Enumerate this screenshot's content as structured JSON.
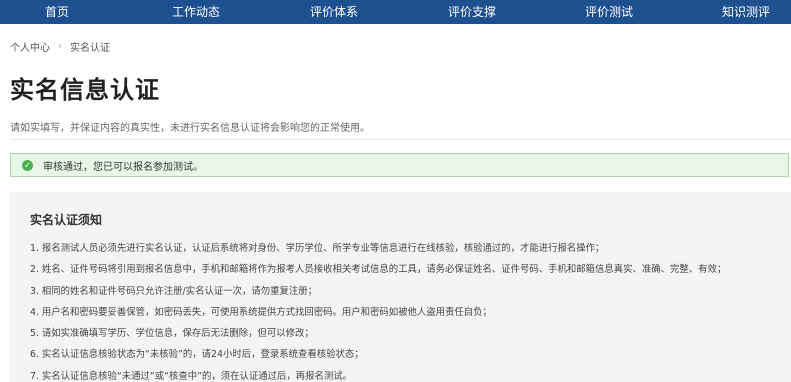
{
  "nav": {
    "items": [
      {
        "label": "首页"
      },
      {
        "label": "工作动态"
      },
      {
        "label": "评价体系"
      },
      {
        "label": "评价支撑"
      },
      {
        "label": "评价测试"
      },
      {
        "label": "知识测评"
      }
    ],
    "bg_color": "#1e4f8e"
  },
  "breadcrumb": {
    "home": "个人中心",
    "separator": "›",
    "current": "实名认证"
  },
  "page": {
    "title": "实名信息认证",
    "description": "请如实填写，并保证内容的真实性，未进行实名信息认证将会影响您的正常使用。"
  },
  "alert": {
    "icon": "check-circle-icon",
    "text": "审核通过，您已可以报名参加测试。",
    "color": "#4caf50"
  },
  "notice": {
    "title": "实名认证须知",
    "items": [
      "1. 报名测试人员必须先进行实名认证，认证后系统将对身份、学历学位、所学专业等信息进行在线核验，核验通过的，才能进行报名操作；",
      "2. 姓名、证件号码将引用到报名信息中，手机和邮箱将作为报考人员接收相关考试信息的工具，请务必保证姓名、证件号码、手机和邮箱信息真实、准确、完整、有效；",
      "3. 相同的姓名和证件号码只允许注册/实名认证一次，请勿重复注册；",
      "4. 用户名和密码要妥善保管，如密码丢失，可使用系统提供方式找回密码。用户和密码如被他人盗用责任自负；",
      "5. 请如实准确填写学历、学位信息，保存后无法删除，但可以修改；",
      "6. 实名认证信息核验状态为“未核验”的，请24小时后，登录系统查看核验状态；",
      "7. 实名认证信息核验“未通过”或“核查中”的，须在认证通过后，再报名测试。"
    ]
  }
}
